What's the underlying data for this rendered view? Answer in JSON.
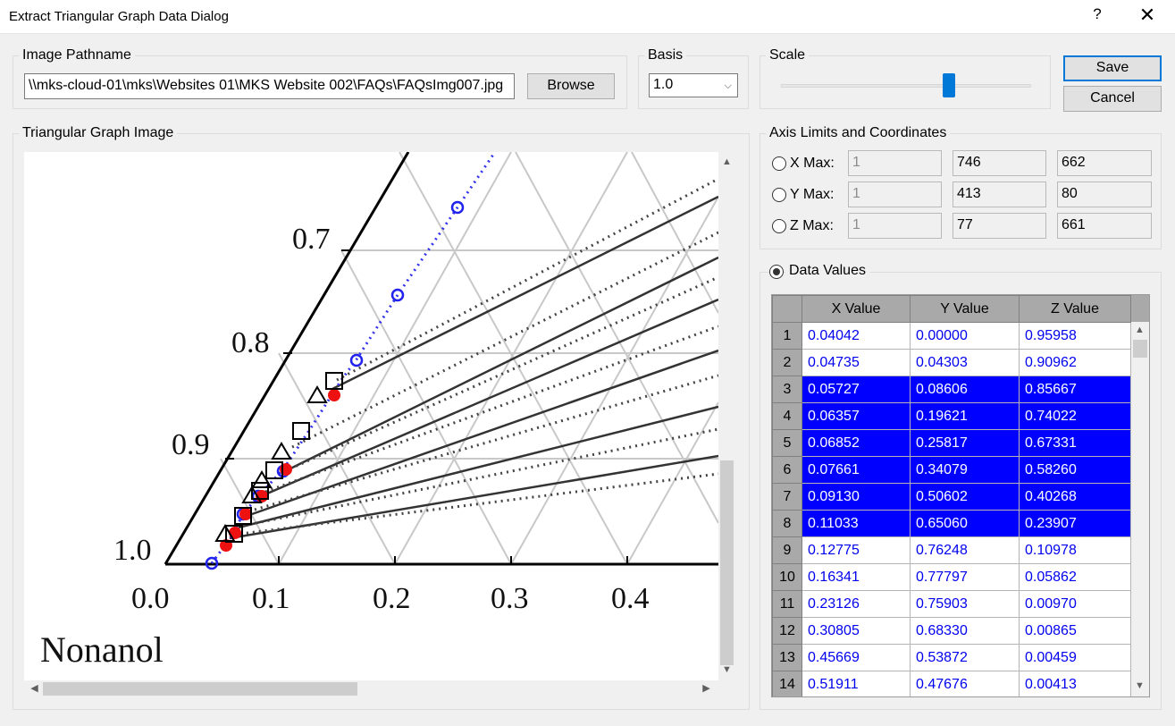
{
  "window": {
    "title": "Extract Triangular Graph Data Dialog",
    "help": "?",
    "close": "✕"
  },
  "image_path": {
    "group_label": "Image Pathname",
    "value": "\\\\mks-cloud-01\\mks\\Websites 01\\MKS Website 002\\FAQs\\FAQsImg007.jpg",
    "browse_label": "Browse"
  },
  "basis": {
    "group_label": "Basis",
    "selected": "1.0"
  },
  "scale": {
    "group_label": "Scale",
    "slider_fraction": 0.68
  },
  "buttons": {
    "save": "Save",
    "cancel": "Cancel"
  },
  "graph": {
    "group_label": "Triangular Graph Image",
    "left_labels": [
      "0.7",
      "0.8",
      "0.9",
      "1.0"
    ],
    "bottom_labels": [
      "0.0",
      "0.1",
      "0.2",
      "0.3",
      "0.4"
    ],
    "caption": "Nonanol"
  },
  "axis_limits": {
    "group_label": "Axis Limits and Coordinates",
    "rows": [
      {
        "label": "X Max:",
        "value": "1",
        "px": "746",
        "py": "662"
      },
      {
        "label": "Y Max:",
        "value": "1",
        "px": "413",
        "py": "80"
      },
      {
        "label": "Z Max:",
        "value": "1",
        "px": "77",
        "py": "661"
      }
    ]
  },
  "data_values": {
    "group_label": "Data Values",
    "columns": [
      "X Value",
      "Y Value",
      "Z Value"
    ],
    "rows": [
      {
        "n": "1",
        "x": "0.04042",
        "y": "0.00000",
        "z": "0.95958",
        "selected": false
      },
      {
        "n": "2",
        "x": "0.04735",
        "y": "0.04303",
        "z": "0.90962",
        "selected": false
      },
      {
        "n": "3",
        "x": "0.05727",
        "y": "0.08606",
        "z": "0.85667",
        "selected": true
      },
      {
        "n": "4",
        "x": "0.06357",
        "y": "0.19621",
        "z": "0.74022",
        "selected": true
      },
      {
        "n": "5",
        "x": "0.06852",
        "y": "0.25817",
        "z": "0.67331",
        "selected": true
      },
      {
        "n": "6",
        "x": "0.07661",
        "y": "0.34079",
        "z": "0.58260",
        "selected": true
      },
      {
        "n": "7",
        "x": "0.09130",
        "y": "0.50602",
        "z": "0.40268",
        "selected": true
      },
      {
        "n": "8",
        "x": "0.11033",
        "y": "0.65060",
        "z": "0.23907",
        "selected": true
      },
      {
        "n": "9",
        "x": "0.12775",
        "y": "0.76248",
        "z": "0.10978",
        "selected": false
      },
      {
        "n": "10",
        "x": "0.16341",
        "y": "0.77797",
        "z": "0.05862",
        "selected": false
      },
      {
        "n": "11",
        "x": "0.23126",
        "y": "0.75903",
        "z": "0.00970",
        "selected": false
      },
      {
        "n": "12",
        "x": "0.30805",
        "y": "0.68330",
        "z": "0.00865",
        "selected": false
      },
      {
        "n": "13",
        "x": "0.45669",
        "y": "0.53872",
        "z": "0.00459",
        "selected": false
      },
      {
        "n": "14",
        "x": "0.51911",
        "y": "0.47676",
        "z": "0.00413",
        "selected": false
      }
    ]
  }
}
